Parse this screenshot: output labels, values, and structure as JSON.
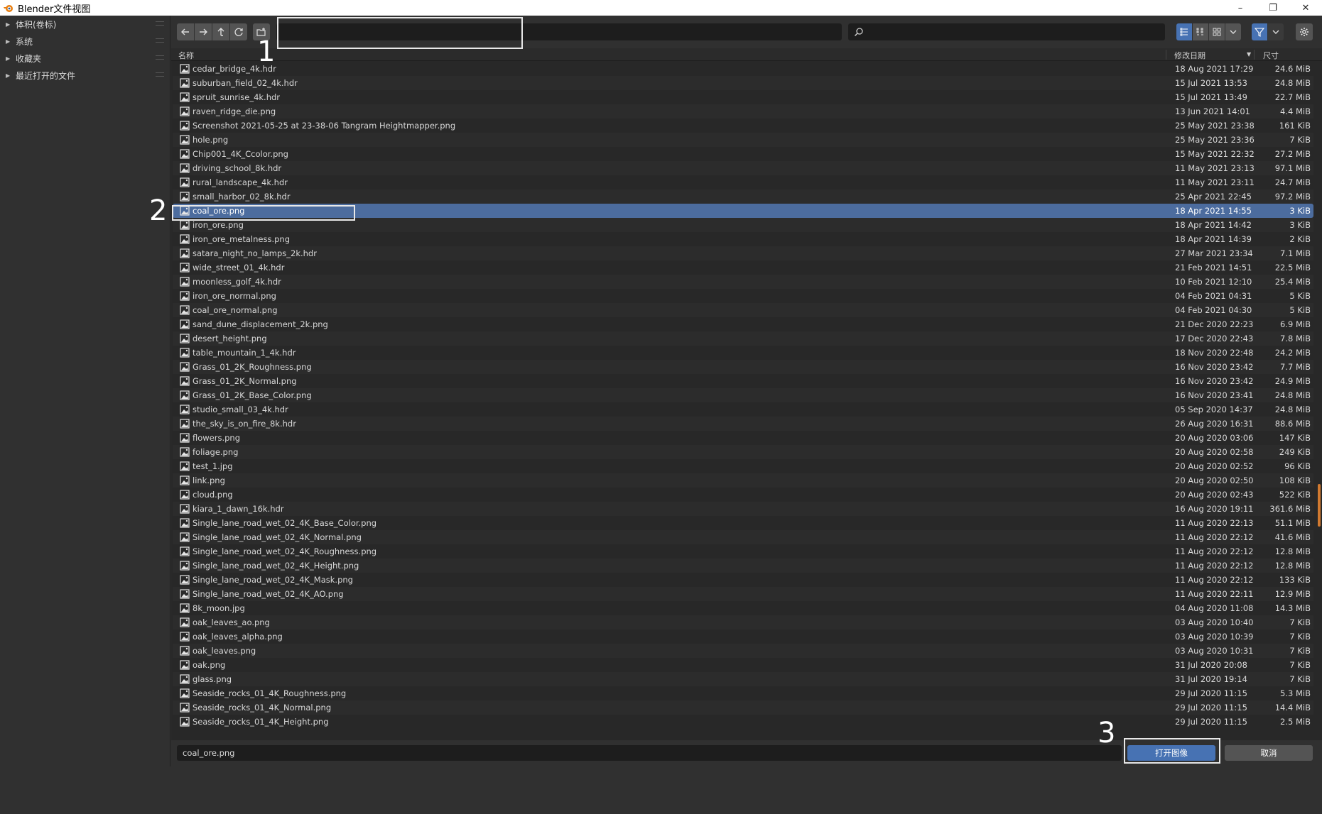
{
  "window": {
    "title": "Blender文件视图",
    "minimize": "–",
    "restore": "❐",
    "close": "✕"
  },
  "sidebar": {
    "sections": [
      {
        "label": "体积(卷标)"
      },
      {
        "label": "系统"
      },
      {
        "label": "收藏夹"
      },
      {
        "label": "最近打开的文件"
      }
    ]
  },
  "toolbar": {
    "path_value": "",
    "search_placeholder": ""
  },
  "columns": {
    "name": "名称",
    "date": "修改日期",
    "size": "尺寸"
  },
  "files": [
    {
      "name": "cedar_bridge_4k.hdr",
      "date": "18 Aug 2021 17:29",
      "size": "24.6 MiB"
    },
    {
      "name": "suburban_field_02_4k.hdr",
      "date": "15 Jul 2021 13:53",
      "size": "24.8 MiB"
    },
    {
      "name": "spruit_sunrise_4k.hdr",
      "date": "15 Jul 2021 13:49",
      "size": "22.7 MiB"
    },
    {
      "name": "raven_ridge_die.png",
      "date": "13 Jun 2021 14:01",
      "size": "4.4 MiB"
    },
    {
      "name": "Screenshot 2021-05-25 at 23-38-06 Tangram Heightmapper.png",
      "date": "25 May 2021 23:38",
      "size": "161 KiB"
    },
    {
      "name": "hole.png",
      "date": "25 May 2021 23:36",
      "size": "7 KiB"
    },
    {
      "name": "Chip001_4K_Ccolor.png",
      "date": "15 May 2021 22:32",
      "size": "27.2 MiB"
    },
    {
      "name": "driving_school_8k.hdr",
      "date": "11 May 2021 23:13",
      "size": "97.1 MiB"
    },
    {
      "name": "rural_landscape_4k.hdr",
      "date": "11 May 2021 23:11",
      "size": "24.7 MiB"
    },
    {
      "name": "small_harbor_02_8k.hdr",
      "date": "25 Apr 2021 22:45",
      "size": "97.2 MiB"
    },
    {
      "name": "coal_ore.png",
      "date": "18 Apr 2021 14:55",
      "size": "3 KiB",
      "selected": true
    },
    {
      "name": "iron_ore.png",
      "date": "18 Apr 2021 14:42",
      "size": "3 KiB"
    },
    {
      "name": "iron_ore_metalness.png",
      "date": "18 Apr 2021 14:39",
      "size": "2 KiB"
    },
    {
      "name": "satara_night_no_lamps_2k.hdr",
      "date": "27 Mar 2021 23:34",
      "size": "7.1 MiB"
    },
    {
      "name": "wide_street_01_4k.hdr",
      "date": "21 Feb 2021 14:51",
      "size": "22.5 MiB"
    },
    {
      "name": "moonless_golf_4k.hdr",
      "date": "10 Feb 2021 12:10",
      "size": "25.4 MiB"
    },
    {
      "name": "iron_ore_normal.png",
      "date": "04 Feb 2021 04:31",
      "size": "5 KiB"
    },
    {
      "name": "coal_ore_normal.png",
      "date": "04 Feb 2021 04:30",
      "size": "5 KiB"
    },
    {
      "name": "sand_dune_displacement_2k.png",
      "date": "21 Dec 2020 22:23",
      "size": "6.9 MiB"
    },
    {
      "name": "desert_height.png",
      "date": "17 Dec 2020 22:43",
      "size": "7.8 MiB"
    },
    {
      "name": "table_mountain_1_4k.hdr",
      "date": "18 Nov 2020 22:48",
      "size": "24.2 MiB"
    },
    {
      "name": "Grass_01_2K_Roughness.png",
      "date": "16 Nov 2020 23:42",
      "size": "7.7 MiB"
    },
    {
      "name": "Grass_01_2K_Normal.png",
      "date": "16 Nov 2020 23:42",
      "size": "24.9 MiB"
    },
    {
      "name": "Grass_01_2K_Base_Color.png",
      "date": "16 Nov 2020 23:41",
      "size": "24.8 MiB"
    },
    {
      "name": "studio_small_03_4k.hdr",
      "date": "05 Sep 2020 14:37",
      "size": "24.8 MiB"
    },
    {
      "name": "the_sky_is_on_fire_8k.hdr",
      "date": "26 Aug 2020 16:31",
      "size": "88.6 MiB"
    },
    {
      "name": "flowers.png",
      "date": "20 Aug 2020 03:06",
      "size": "147 KiB"
    },
    {
      "name": "foliage.png",
      "date": "20 Aug 2020 02:58",
      "size": "249 KiB"
    },
    {
      "name": "test_1.jpg",
      "date": "20 Aug 2020 02:52",
      "size": "96 KiB"
    },
    {
      "name": "link.png",
      "date": "20 Aug 2020 02:50",
      "size": "108 KiB"
    },
    {
      "name": "cloud.png",
      "date": "20 Aug 2020 02:43",
      "size": "522 KiB"
    },
    {
      "name": "kiara_1_dawn_16k.hdr",
      "date": "16 Aug 2020 19:11",
      "size": "361.6 MiB"
    },
    {
      "name": "Single_lane_road_wet_02_4K_Base_Color.png",
      "date": "11 Aug 2020 22:13",
      "size": "51.1 MiB"
    },
    {
      "name": "Single_lane_road_wet_02_4K_Normal.png",
      "date": "11 Aug 2020 22:12",
      "size": "41.6 MiB"
    },
    {
      "name": "Single_lane_road_wet_02_4K_Roughness.png",
      "date": "11 Aug 2020 22:12",
      "size": "12.8 MiB"
    },
    {
      "name": "Single_lane_road_wet_02_4K_Height.png",
      "date": "11 Aug 2020 22:12",
      "size": "12.8 MiB"
    },
    {
      "name": "Single_lane_road_wet_02_4K_Mask.png",
      "date": "11 Aug 2020 22:12",
      "size": "133 KiB"
    },
    {
      "name": "Single_lane_road_wet_02_4K_AO.png",
      "date": "11 Aug 2020 22:11",
      "size": "12.9 MiB"
    },
    {
      "name": "8k_moon.jpg",
      "date": "04 Aug 2020 11:08",
      "size": "14.3 MiB"
    },
    {
      "name": "oak_leaves_ao.png",
      "date": "03 Aug 2020 10:40",
      "size": "7 KiB"
    },
    {
      "name": "oak_leaves_alpha.png",
      "date": "03 Aug 2020 10:39",
      "size": "7 KiB"
    },
    {
      "name": "oak_leaves.png",
      "date": "03 Aug 2020 10:31",
      "size": "7 KiB"
    },
    {
      "name": "oak.png",
      "date": "31 Jul 2020 20:08",
      "size": "7 KiB"
    },
    {
      "name": "glass.png",
      "date": "31 Jul 2020 19:14",
      "size": "7 KiB"
    },
    {
      "name": "Seaside_rocks_01_4K_Roughness.png",
      "date": "29 Jul 2020 11:15",
      "size": "5.3 MiB"
    },
    {
      "name": "Seaside_rocks_01_4K_Normal.png",
      "date": "29 Jul 2020 11:15",
      "size": "14.4 MiB"
    },
    {
      "name": "Seaside_rocks_01_4K_Height.png",
      "date": "29 Jul 2020 11:15",
      "size": "2.5 MiB"
    }
  ],
  "bottom": {
    "filename": "coal_ore.png",
    "open_label": "打开图像",
    "cancel_label": "取消"
  },
  "annotations": {
    "one": "1",
    "two": "2",
    "three": "3"
  },
  "colors": {
    "accent": "#4772b3",
    "selected_row": "#4c6c9e",
    "background": "#282828",
    "panel": "#303030"
  }
}
